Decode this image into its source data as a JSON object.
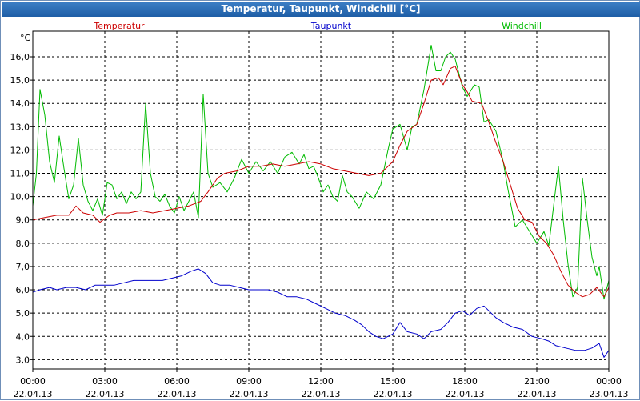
{
  "window": {
    "title": "Temperatur, Taupunkt, Windchill [°C]"
  },
  "chart_data": {
    "type": "line",
    "ylabel": "°C",
    "ylim": [
      2.6,
      17.1
    ],
    "yticks": [
      "3,0",
      "4,0",
      "5,0",
      "6,0",
      "7,0",
      "8,0",
      "9,0",
      "10,0",
      "11,0",
      "12,0",
      "13,0",
      "14,0",
      "15,0",
      "16,0"
    ],
    "ytick_values": [
      3,
      4,
      5,
      6,
      7,
      8,
      9,
      10,
      11,
      12,
      13,
      14,
      15,
      16
    ],
    "xlim": [
      0,
      24
    ],
    "xticks": [
      {
        "x": 0,
        "time": "00:00",
        "date": "22.04.13"
      },
      {
        "x": 3,
        "time": "03:00",
        "date": "22.04.13"
      },
      {
        "x": 6,
        "time": "06:00",
        "date": "22.04.13"
      },
      {
        "x": 9,
        "time": "09:00",
        "date": "22.04.13"
      },
      {
        "x": 12,
        "time": "12:00",
        "date": "22.04.13"
      },
      {
        "x": 15,
        "time": "15:00",
        "date": "22.04.13"
      },
      {
        "x": 18,
        "time": "18:00",
        "date": "22.04.13"
      },
      {
        "x": 21,
        "time": "21:00",
        "date": "22.04.13"
      },
      {
        "x": 24,
        "time": "00:00",
        "date": "23.04.13"
      }
    ],
    "grid": true,
    "legend_position": "top",
    "series": [
      {
        "name": "Temperatur",
        "color": "#cc0000",
        "points": [
          [
            0,
            9.0
          ],
          [
            0.5,
            9.1
          ],
          [
            1.0,
            9.2
          ],
          [
            1.5,
            9.2
          ],
          [
            1.8,
            9.6
          ],
          [
            2.1,
            9.3
          ],
          [
            2.5,
            9.2
          ],
          [
            2.8,
            8.9
          ],
          [
            3.2,
            9.2
          ],
          [
            3.5,
            9.3
          ],
          [
            4.0,
            9.3
          ],
          [
            4.5,
            9.4
          ],
          [
            5.0,
            9.3
          ],
          [
            5.5,
            9.4
          ],
          [
            6.0,
            9.5
          ],
          [
            6.5,
            9.6
          ],
          [
            7.0,
            9.8
          ],
          [
            7.3,
            10.2
          ],
          [
            7.7,
            10.8
          ],
          [
            8.0,
            11.0
          ],
          [
            8.5,
            11.1
          ],
          [
            9.0,
            11.3
          ],
          [
            9.5,
            11.3
          ],
          [
            10.0,
            11.4
          ],
          [
            10.5,
            11.3
          ],
          [
            11.0,
            11.4
          ],
          [
            11.5,
            11.5
          ],
          [
            12.0,
            11.4
          ],
          [
            12.5,
            11.2
          ],
          [
            13.0,
            11.1
          ],
          [
            13.5,
            11.0
          ],
          [
            14.0,
            10.9
          ],
          [
            14.5,
            11.0
          ],
          [
            15.0,
            11.5
          ],
          [
            15.3,
            12.2
          ],
          [
            15.6,
            12.8
          ],
          [
            16.0,
            13.1
          ],
          [
            16.3,
            14.0
          ],
          [
            16.6,
            15.0
          ],
          [
            16.9,
            15.1
          ],
          [
            17.1,
            14.8
          ],
          [
            17.4,
            15.5
          ],
          [
            17.6,
            15.6
          ],
          [
            17.9,
            14.8
          ],
          [
            18.1,
            14.5
          ],
          [
            18.3,
            14.1
          ],
          [
            18.7,
            14.0
          ],
          [
            19.0,
            13.2
          ],
          [
            19.3,
            12.3
          ],
          [
            19.6,
            11.5
          ],
          [
            19.9,
            10.5
          ],
          [
            20.2,
            9.5
          ],
          [
            20.5,
            9.0
          ],
          [
            20.8,
            8.9
          ],
          [
            21.1,
            8.3
          ],
          [
            21.4,
            8.0
          ],
          [
            21.7,
            7.5
          ],
          [
            22.0,
            6.8
          ],
          [
            22.3,
            6.2
          ],
          [
            22.6,
            5.9
          ],
          [
            22.9,
            5.7
          ],
          [
            23.2,
            5.8
          ],
          [
            23.5,
            6.1
          ],
          [
            23.8,
            5.7
          ],
          [
            24.0,
            6.1
          ]
        ]
      },
      {
        "name": "Taupunkt",
        "color": "#0000cc",
        "points": [
          [
            0,
            5.9
          ],
          [
            0.3,
            6.0
          ],
          [
            0.7,
            6.1
          ],
          [
            1.0,
            6.0
          ],
          [
            1.4,
            6.1
          ],
          [
            1.8,
            6.1
          ],
          [
            2.2,
            6.0
          ],
          [
            2.6,
            6.2
          ],
          [
            3.0,
            6.2
          ],
          [
            3.4,
            6.2
          ],
          [
            3.8,
            6.3
          ],
          [
            4.2,
            6.4
          ],
          [
            4.6,
            6.4
          ],
          [
            5.0,
            6.4
          ],
          [
            5.4,
            6.4
          ],
          [
            5.8,
            6.5
          ],
          [
            6.2,
            6.6
          ],
          [
            6.6,
            6.8
          ],
          [
            6.9,
            6.9
          ],
          [
            7.2,
            6.7
          ],
          [
            7.5,
            6.3
          ],
          [
            7.8,
            6.2
          ],
          [
            8.2,
            6.2
          ],
          [
            8.6,
            6.1
          ],
          [
            9.0,
            6.0
          ],
          [
            9.4,
            6.0
          ],
          [
            9.8,
            6.0
          ],
          [
            10.2,
            5.9
          ],
          [
            10.6,
            5.7
          ],
          [
            11.0,
            5.7
          ],
          [
            11.4,
            5.6
          ],
          [
            11.8,
            5.4
          ],
          [
            12.2,
            5.2
          ],
          [
            12.6,
            5.0
          ],
          [
            13.0,
            4.9
          ],
          [
            13.4,
            4.7
          ],
          [
            13.7,
            4.5
          ],
          [
            14.0,
            4.2
          ],
          [
            14.3,
            4.0
          ],
          [
            14.6,
            3.9
          ],
          [
            15.0,
            4.1
          ],
          [
            15.3,
            4.6
          ],
          [
            15.6,
            4.2
          ],
          [
            16.0,
            4.1
          ],
          [
            16.3,
            3.9
          ],
          [
            16.6,
            4.2
          ],
          [
            17.0,
            4.3
          ],
          [
            17.3,
            4.6
          ],
          [
            17.6,
            5.0
          ],
          [
            17.9,
            5.1
          ],
          [
            18.2,
            4.9
          ],
          [
            18.5,
            5.2
          ],
          [
            18.8,
            5.3
          ],
          [
            19.0,
            5.1
          ],
          [
            19.3,
            4.8
          ],
          [
            19.6,
            4.6
          ],
          [
            20.0,
            4.4
          ],
          [
            20.4,
            4.3
          ],
          [
            20.8,
            4.0
          ],
          [
            21.2,
            3.9
          ],
          [
            21.5,
            3.8
          ],
          [
            21.8,
            3.6
          ],
          [
            22.2,
            3.5
          ],
          [
            22.6,
            3.4
          ],
          [
            23.0,
            3.4
          ],
          [
            23.3,
            3.5
          ],
          [
            23.6,
            3.7
          ],
          [
            23.8,
            3.1
          ],
          [
            24.0,
            3.4
          ]
        ]
      },
      {
        "name": "Windchill",
        "color": "#00bb00",
        "points": [
          [
            0,
            9.6
          ],
          [
            0.15,
            11.0
          ],
          [
            0.3,
            14.6
          ],
          [
            0.5,
            13.5
          ],
          [
            0.7,
            11.5
          ],
          [
            0.9,
            10.6
          ],
          [
            1.1,
            12.6
          ],
          [
            1.3,
            11.2
          ],
          [
            1.5,
            9.9
          ],
          [
            1.7,
            10.5
          ],
          [
            1.9,
            12.5
          ],
          [
            2.1,
            10.5
          ],
          [
            2.3,
            9.8
          ],
          [
            2.5,
            9.4
          ],
          [
            2.7,
            9.9
          ],
          [
            2.9,
            9.2
          ],
          [
            3.1,
            10.6
          ],
          [
            3.3,
            10.5
          ],
          [
            3.5,
            9.9
          ],
          [
            3.7,
            10.2
          ],
          [
            3.9,
            9.7
          ],
          [
            4.1,
            10.2
          ],
          [
            4.3,
            9.9
          ],
          [
            4.5,
            10.2
          ],
          [
            4.7,
            14.0
          ],
          [
            4.9,
            11.0
          ],
          [
            5.1,
            10.0
          ],
          [
            5.3,
            9.8
          ],
          [
            5.5,
            10.1
          ],
          [
            5.7,
            9.6
          ],
          [
            5.9,
            9.3
          ],
          [
            6.1,
            10.0
          ],
          [
            6.3,
            9.4
          ],
          [
            6.5,
            9.8
          ],
          [
            6.7,
            10.2
          ],
          [
            6.9,
            9.1
          ],
          [
            7.1,
            14.4
          ],
          [
            7.3,
            11.0
          ],
          [
            7.5,
            10.4
          ],
          [
            7.8,
            10.6
          ],
          [
            8.1,
            10.2
          ],
          [
            8.4,
            10.8
          ],
          [
            8.7,
            11.6
          ],
          [
            9.0,
            11.0
          ],
          [
            9.3,
            11.5
          ],
          [
            9.6,
            11.1
          ],
          [
            9.9,
            11.5
          ],
          [
            10.2,
            11.0
          ],
          [
            10.5,
            11.7
          ],
          [
            10.8,
            11.9
          ],
          [
            11.1,
            11.4
          ],
          [
            11.3,
            11.8
          ],
          [
            11.5,
            11.2
          ],
          [
            11.7,
            11.3
          ],
          [
            11.9,
            10.8
          ],
          [
            12.1,
            10.2
          ],
          [
            12.3,
            10.5
          ],
          [
            12.5,
            10.0
          ],
          [
            12.7,
            9.8
          ],
          [
            12.9,
            10.9
          ],
          [
            13.1,
            10.2
          ],
          [
            13.3,
            10.0
          ],
          [
            13.6,
            9.5
          ],
          [
            13.9,
            10.2
          ],
          [
            14.2,
            9.9
          ],
          [
            14.5,
            10.5
          ],
          [
            14.8,
            12.0
          ],
          [
            15.0,
            12.9
          ],
          [
            15.3,
            13.1
          ],
          [
            15.6,
            12.0
          ],
          [
            15.8,
            13.0
          ],
          [
            16.0,
            13.1
          ],
          [
            16.3,
            14.6
          ],
          [
            16.6,
            16.5
          ],
          [
            16.8,
            15.4
          ],
          [
            17.0,
            15.4
          ],
          [
            17.2,
            16.0
          ],
          [
            17.4,
            16.2
          ],
          [
            17.6,
            15.9
          ],
          [
            17.9,
            14.7
          ],
          [
            18.1,
            14.3
          ],
          [
            18.4,
            14.8
          ],
          [
            18.6,
            14.7
          ],
          [
            18.8,
            13.2
          ],
          [
            19.0,
            13.3
          ],
          [
            19.3,
            12.8
          ],
          [
            19.6,
            11.5
          ],
          [
            19.8,
            10.3
          ],
          [
            20.1,
            8.7
          ],
          [
            20.4,
            9.0
          ],
          [
            20.7,
            8.5
          ],
          [
            21.0,
            8.0
          ],
          [
            21.3,
            8.5
          ],
          [
            21.5,
            7.9
          ],
          [
            21.7,
            9.6
          ],
          [
            21.9,
            11.3
          ],
          [
            22.1,
            9.0
          ],
          [
            22.3,
            7.1
          ],
          [
            22.5,
            5.7
          ],
          [
            22.7,
            6.1
          ],
          [
            22.9,
            10.8
          ],
          [
            23.1,
            9.0
          ],
          [
            23.3,
            7.4
          ],
          [
            23.5,
            6.6
          ],
          [
            23.6,
            7.0
          ],
          [
            23.8,
            5.6
          ],
          [
            24.0,
            6.4
          ]
        ]
      }
    ]
  }
}
